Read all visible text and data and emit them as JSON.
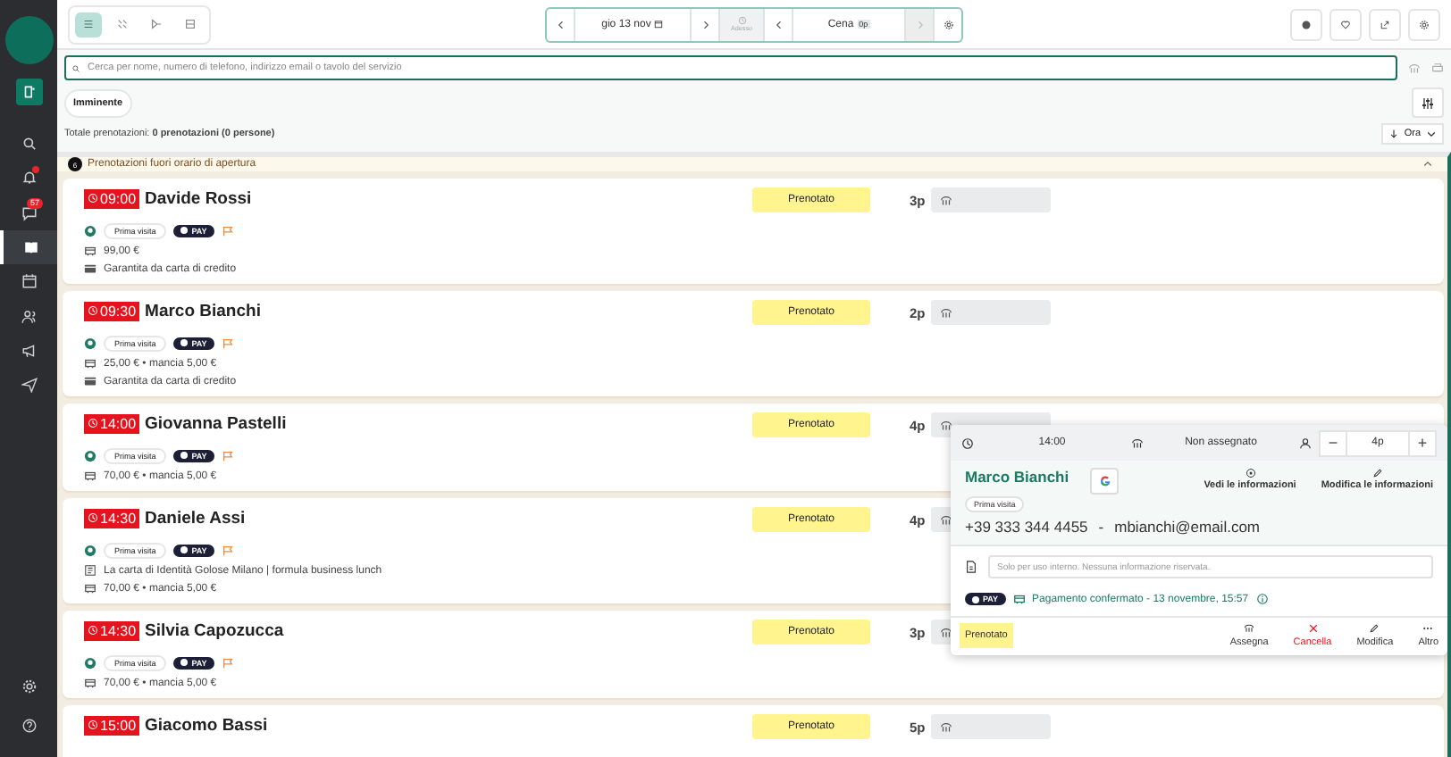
{
  "sidebar": {
    "items": [
      {
        "kind": "new",
        "selected": false
      },
      {
        "kind": "search",
        "selected": false
      },
      {
        "kind": "bell",
        "selected": false,
        "dot": true
      },
      {
        "kind": "chat",
        "selected": false,
        "badge": "57"
      },
      {
        "kind": "book",
        "selected": true
      },
      {
        "kind": "calendar",
        "selected": false
      },
      {
        "kind": "people",
        "selected": false
      },
      {
        "kind": "megaphone",
        "selected": false
      },
      {
        "kind": "send",
        "selected": false
      },
      {
        "kind": "gear",
        "selected": false
      },
      {
        "kind": "help",
        "selected": false
      }
    ]
  },
  "toolbar": {
    "views": [
      {
        "selected": true
      },
      {
        "selected": false
      },
      {
        "selected": false
      },
      {
        "selected": false
      }
    ],
    "date": "gio 13 nov",
    "now_label": "Adesso",
    "service": "Cena",
    "service_count": "0p"
  },
  "search": {
    "placeholder": "Cerca per nome, numero di telefono, indirizzo email o tavolo del servizio"
  },
  "filters": [
    {
      "label": "Imminente"
    }
  ],
  "summary": "Totale prenotazioni: **0 prenotazioni (0 persone)**",
  "sort": {
    "label": "Ora"
  },
  "section": {
    "count": "6",
    "title": "Prenotazioni fuori orario di apertura",
    "expanded": true
  },
  "reservations": [
    {
      "time": "09:00",
      "name": "Davide Rossi",
      "tag": "Prima visita",
      "pay": "PAY",
      "lines": [
        {
          "kind": "price",
          "text": "99,00 €"
        },
        {
          "kind": "card",
          "text": "Garantita da carta di credito"
        }
      ],
      "status": "Prenotato",
      "covers": "3p"
    },
    {
      "time": "09:30",
      "name": "Marco Bianchi",
      "tag": "Prima visita",
      "pay": "PAY",
      "lines": [
        {
          "kind": "price",
          "text": "25,00 € • mancia 5,00 €"
        },
        {
          "kind": "card",
          "text": "Garantita da carta di credito"
        }
      ],
      "status": "Prenotato",
      "covers": "2p"
    },
    {
      "time": "14:00",
      "name": "Giovanna Pastelli",
      "tag": "Prima visita",
      "pay": "PAY",
      "lines": [
        {
          "kind": "price",
          "text": "70,00 € • mancia 5,00 €"
        }
      ],
      "status": "Prenotato",
      "covers": "4p"
    },
    {
      "time": "14:30",
      "name": "Daniele Assi",
      "tag": "Prima visita",
      "pay": "PAY",
      "lines": [
        {
          "kind": "menu",
          "text": "La carta di Identità Golose Milano | formula business lunch"
        },
        {
          "kind": "price",
          "text": "70,00 € • mancia 5,00 €"
        }
      ],
      "status": "Prenotato",
      "covers": "4p"
    },
    {
      "time": "14:30",
      "name": "Silvia Capozucca",
      "tag": "Prima visita",
      "pay": "PAY",
      "lines": [
        {
          "kind": "price",
          "text": "70,00 € • mancia 5,00 €"
        }
      ],
      "status": "Prenotato",
      "covers": "3p"
    },
    {
      "time": "15:00",
      "name": "Giacomo Bassi",
      "status": "Prenotato",
      "covers": "5p"
    }
  ],
  "popup": {
    "time": "14:00",
    "table": "Non assegnato",
    "covers": "4p",
    "minus": "−",
    "plus": "+",
    "name": "Marco Bianchi",
    "view_info": "Vedi le informazioni",
    "edit_info": "Modifica le informazioni",
    "tag": "Prima visita",
    "phone": "+39 333 344 4455",
    "separator": "-",
    "email": "mbianchi@email.com",
    "notes_placeholder": "Solo per uso interno. Nessuna informazione riservata.",
    "pay": "PAY",
    "payment": "Pagamento confermato - 13 novembre, 15:57",
    "status": "Prenotato",
    "actions": [
      {
        "kind": "assign",
        "label": "Assegna"
      },
      {
        "kind": "cancel",
        "label": "Cancella"
      },
      {
        "kind": "edit",
        "label": "Modifica"
      },
      {
        "kind": "more",
        "label": "Altro"
      }
    ]
  }
}
